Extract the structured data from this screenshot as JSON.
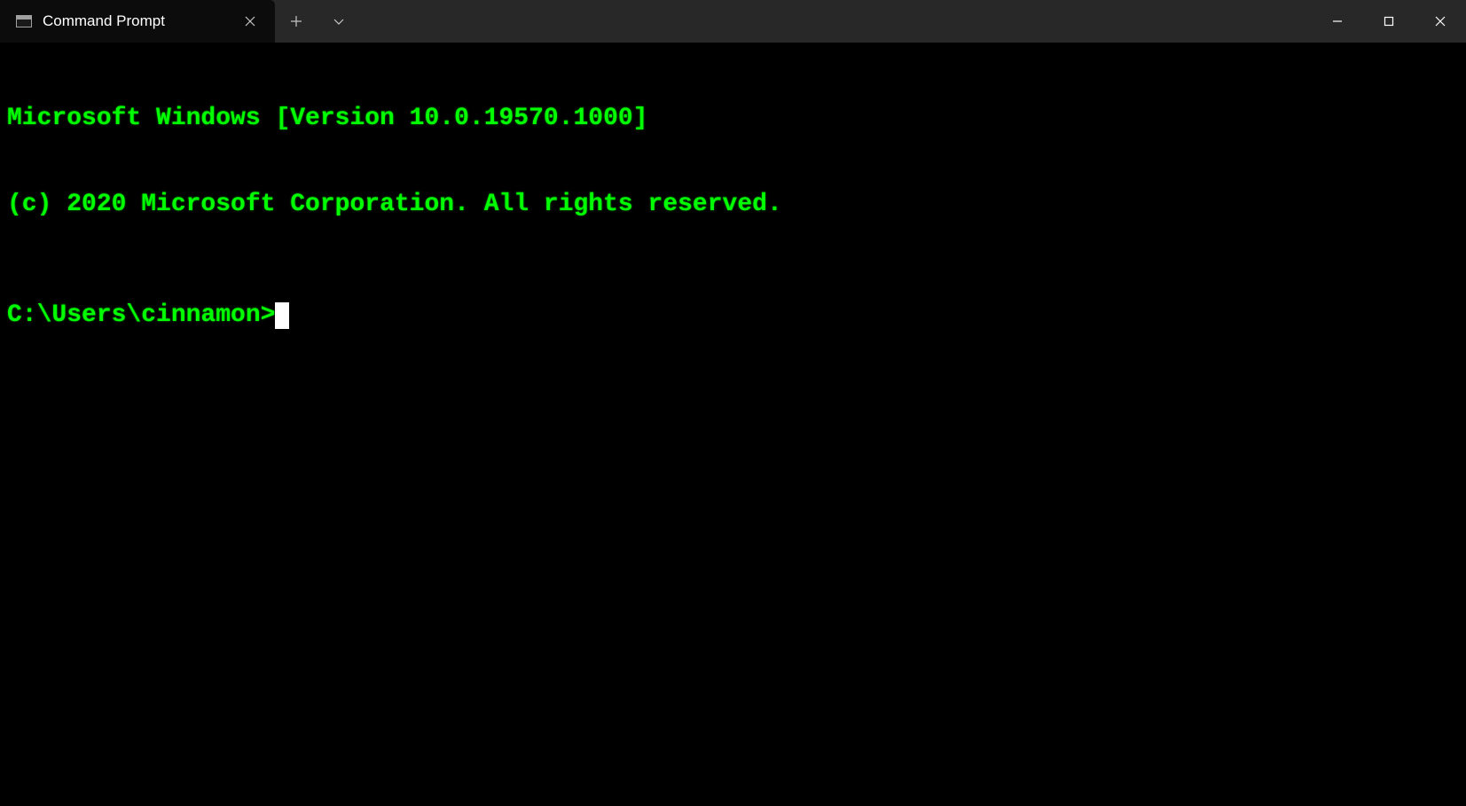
{
  "window": {
    "tab": {
      "title": "Command Prompt",
      "icon": "terminal-icon"
    }
  },
  "terminal": {
    "lines": [
      "Microsoft Windows [Version 10.0.19570.1000]",
      "(c) 2020 Microsoft Corporation. All rights reserved."
    ],
    "prompt": "C:\\Users\\cinnamon>",
    "text_color": "#00ff00",
    "background_color": "#000000"
  }
}
